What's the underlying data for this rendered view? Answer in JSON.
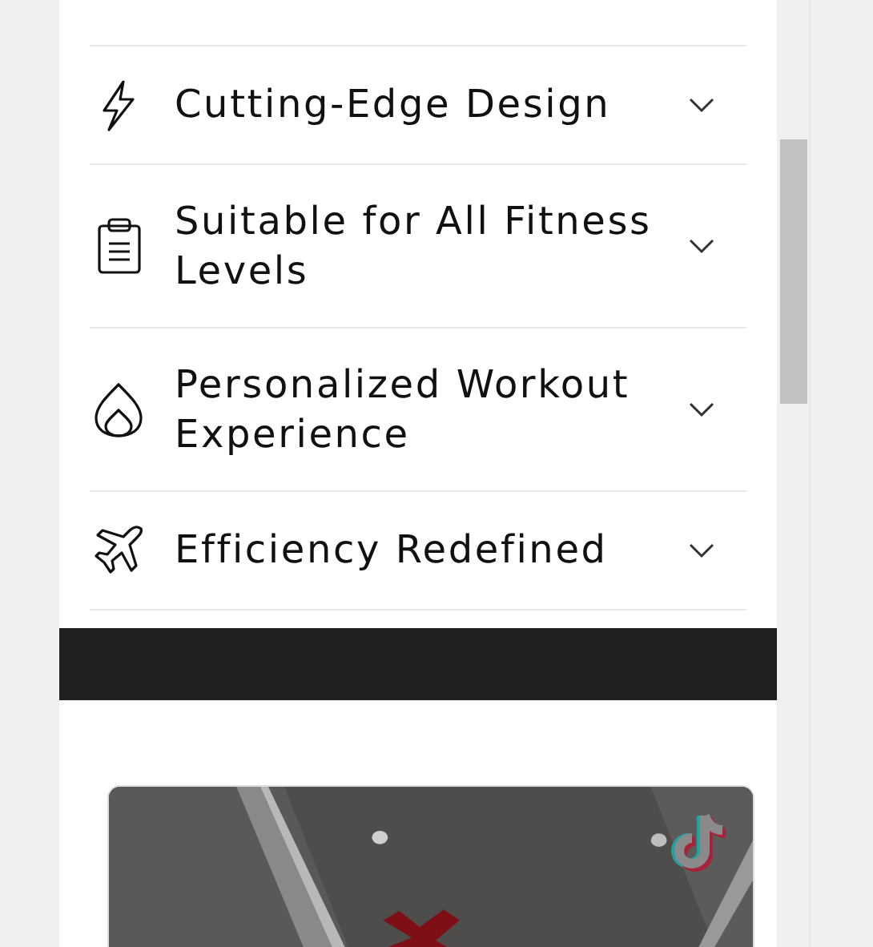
{
  "accordion": [
    {
      "title": "Cutting-Edge Design",
      "expanded": false
    },
    {
      "title": "Suitable for All Fitness Levels",
      "expanded": false
    },
    {
      "title": "Personalized Workout Experience",
      "expanded": false
    },
    {
      "title": "Efficiency Redefined",
      "expanded": false
    }
  ]
}
